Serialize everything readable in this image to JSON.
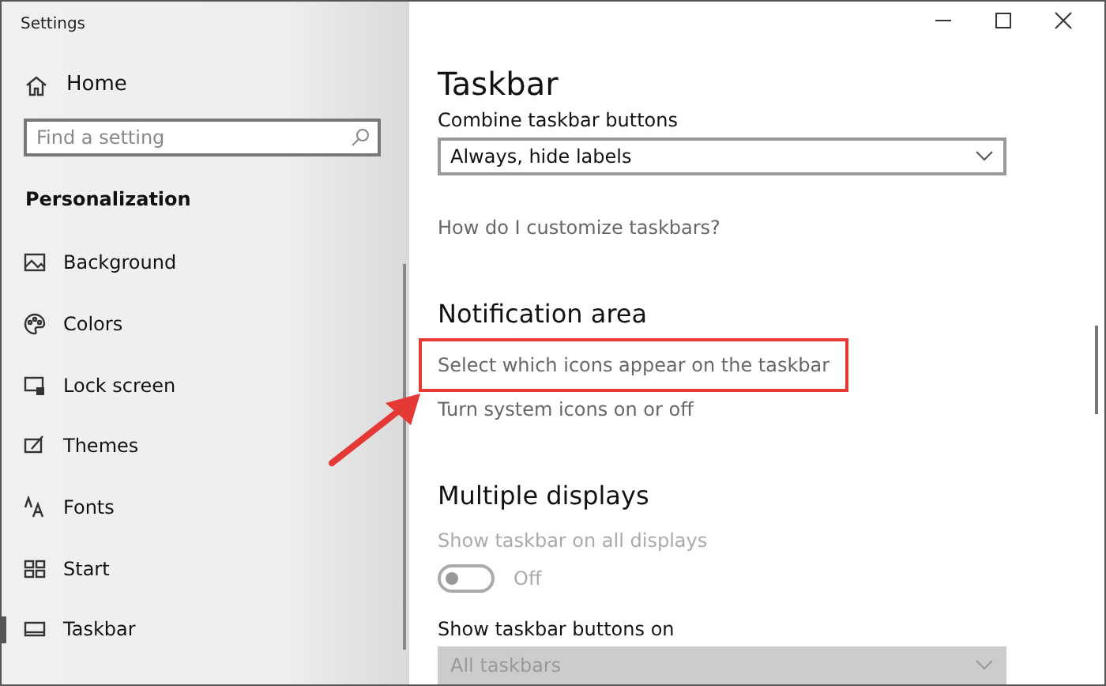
{
  "window": {
    "title": "Settings"
  },
  "sidebar": {
    "home": "Home",
    "search": {
      "placeholder": "Find a setting"
    },
    "section": "Personalization",
    "items": [
      {
        "label": "Background",
        "kind": "picture",
        "selected": false
      },
      {
        "label": "Colors",
        "kind": "palette",
        "selected": false
      },
      {
        "label": "Lock screen",
        "kind": "lock",
        "selected": false
      },
      {
        "label": "Themes",
        "kind": "brush",
        "selected": false
      },
      {
        "label": "Fonts",
        "kind": "fonts",
        "selected": false
      },
      {
        "label": "Start",
        "kind": "start",
        "selected": false
      },
      {
        "label": "Taskbar",
        "kind": "taskbar",
        "selected": true
      }
    ]
  },
  "page": {
    "title": "Taskbar",
    "content": [
      {
        "kind": "label",
        "text": "Combine taskbar buttons",
        "disabled": false
      },
      {
        "kind": "dropdown",
        "value": "Always, hide labels",
        "disabled": false
      },
      {
        "kind": "link",
        "text": "How do I customize taskbars?",
        "highlighted": false
      },
      {
        "kind": "heading",
        "text": "Notification area"
      },
      {
        "kind": "link",
        "text": "Select which icons appear on the taskbar",
        "highlighted": true
      },
      {
        "kind": "link",
        "text": "Turn system icons on or off",
        "highlighted": false
      },
      {
        "kind": "heading",
        "text": "Multiple displays"
      },
      {
        "kind": "label",
        "text": "Show taskbar on all displays",
        "disabled": true
      },
      {
        "kind": "toggle",
        "on": false,
        "state_text": "Off",
        "disabled": true
      },
      {
        "kind": "label",
        "text": "Show taskbar buttons on",
        "disabled": false
      },
      {
        "kind": "dropdown",
        "value": "All taskbars",
        "disabled": true
      }
    ]
  }
}
